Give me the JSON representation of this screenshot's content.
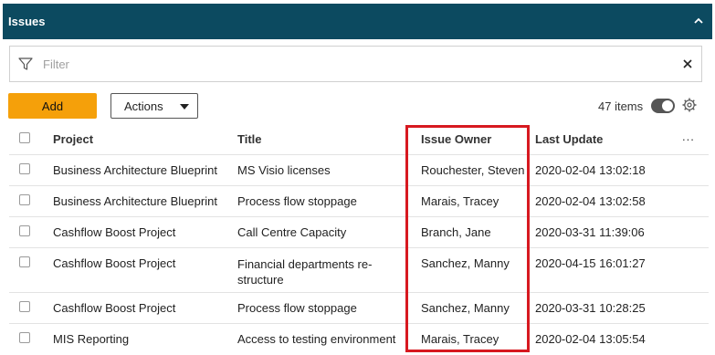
{
  "panel": {
    "title": "Issues"
  },
  "filter": {
    "placeholder": "Filter"
  },
  "toolbar": {
    "add_label": "Add",
    "actions_label": "Actions",
    "items_count": "47 items"
  },
  "table": {
    "columns": [
      "Project",
      "Title",
      "Issue Owner",
      "Last Update",
      "..."
    ],
    "rows": [
      {
        "project": "Business Architecture Blueprint",
        "title": "MS Visio licenses",
        "owner": "Rouchester, Steven",
        "updated": "2020-02-04 13:02:18"
      },
      {
        "project": "Business Architecture Blueprint",
        "title": "Process flow stoppage",
        "owner": "Marais, Tracey",
        "updated": "2020-02-04 13:02:58"
      },
      {
        "project": "Cashflow Boost Project",
        "title": "Call Centre Capacity",
        "owner": "Branch, Jane",
        "updated": "2020-03-31 11:39:06"
      },
      {
        "project": "Cashflow Boost Project",
        "title": "Financial departments re-structure",
        "owner": "Sanchez, Manny",
        "updated": "2020-04-15 16:01:27"
      },
      {
        "project": "Cashflow Boost Project",
        "title": "Process flow stoppage",
        "owner": "Sanchez, Manny",
        "updated": "2020-03-31 10:28:25"
      },
      {
        "project": "MIS Reporting",
        "title": "Access to testing environment",
        "owner": "Marais, Tracey",
        "updated": "2020-02-04 13:05:54"
      }
    ]
  },
  "colors": {
    "header_bg": "#0c4a60",
    "add_button": "#f5a00a",
    "highlight": "#d71920"
  }
}
